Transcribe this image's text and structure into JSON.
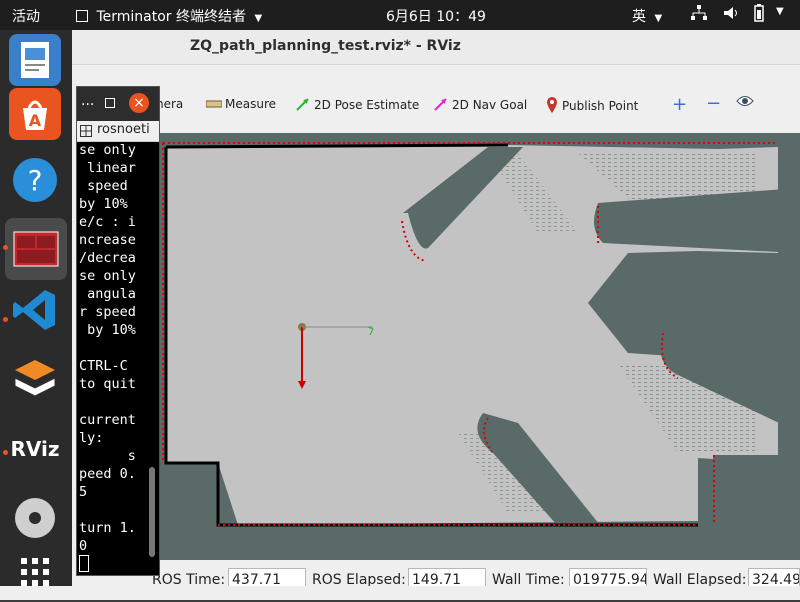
{
  "topbar": {
    "activities": "活动",
    "app_name": "Terminator 终端终结者",
    "clock": "6月6日  10：49",
    "input_method": "英"
  },
  "dock": {
    "items": [
      {
        "name": "document-viewer-icon"
      },
      {
        "name": "software-store-icon"
      },
      {
        "name": "help-icon"
      },
      {
        "name": "terminator-icon"
      },
      {
        "name": "vscode-icon"
      },
      {
        "name": "layers-app-icon"
      },
      {
        "name": "rviz-icon",
        "label": "RViz"
      },
      {
        "name": "disc-icon"
      },
      {
        "name": "show-apps-icon"
      }
    ]
  },
  "rviz": {
    "window_title": "ZQ_path_planning_test.rviz* - RViz",
    "toolbar": {
      "camera_label": "nera",
      "measure_label": "Measure",
      "pose_estimate_label": "2D Pose Estimate",
      "nav_goal_label": "2D Nav Goal",
      "publish_point_label": "Publish Point"
    },
    "status": {
      "ros_time_label": "ROS Time:",
      "ros_time_value": "437.71",
      "ros_elapsed_label": "ROS Elapsed:",
      "ros_elapsed_value": "149.71",
      "wall_time_label": "Wall Time:",
      "wall_time_value": "019775.94",
      "wall_elapsed_label": "Wall Elapsed:",
      "wall_elapsed_value": "324.49"
    }
  },
  "terminal": {
    "close_symbol": "×",
    "menu_symbol": "...",
    "tab_label": "rosnoeti",
    "lines": [
      "se only",
      " linear",
      " speed",
      "by 10%",
      "e/c : i",
      "ncrease",
      "/decrea",
      "se only",
      " angula",
      "r speed",
      " by 10%",
      "",
      "CTRL-C",
      "to quit",
      "",
      "current",
      "ly:",
      "      s",
      "peed 0.",
      "5",
      "",
      "turn 1.",
      "0"
    ]
  },
  "colors": {
    "map_unknown": "#5a6a68",
    "map_free": "#c3c3c3",
    "map_obstacle": "#000000",
    "laser_points": "#e00000",
    "robot_axis_red": "#cc0000",
    "accent": "#e95420"
  }
}
